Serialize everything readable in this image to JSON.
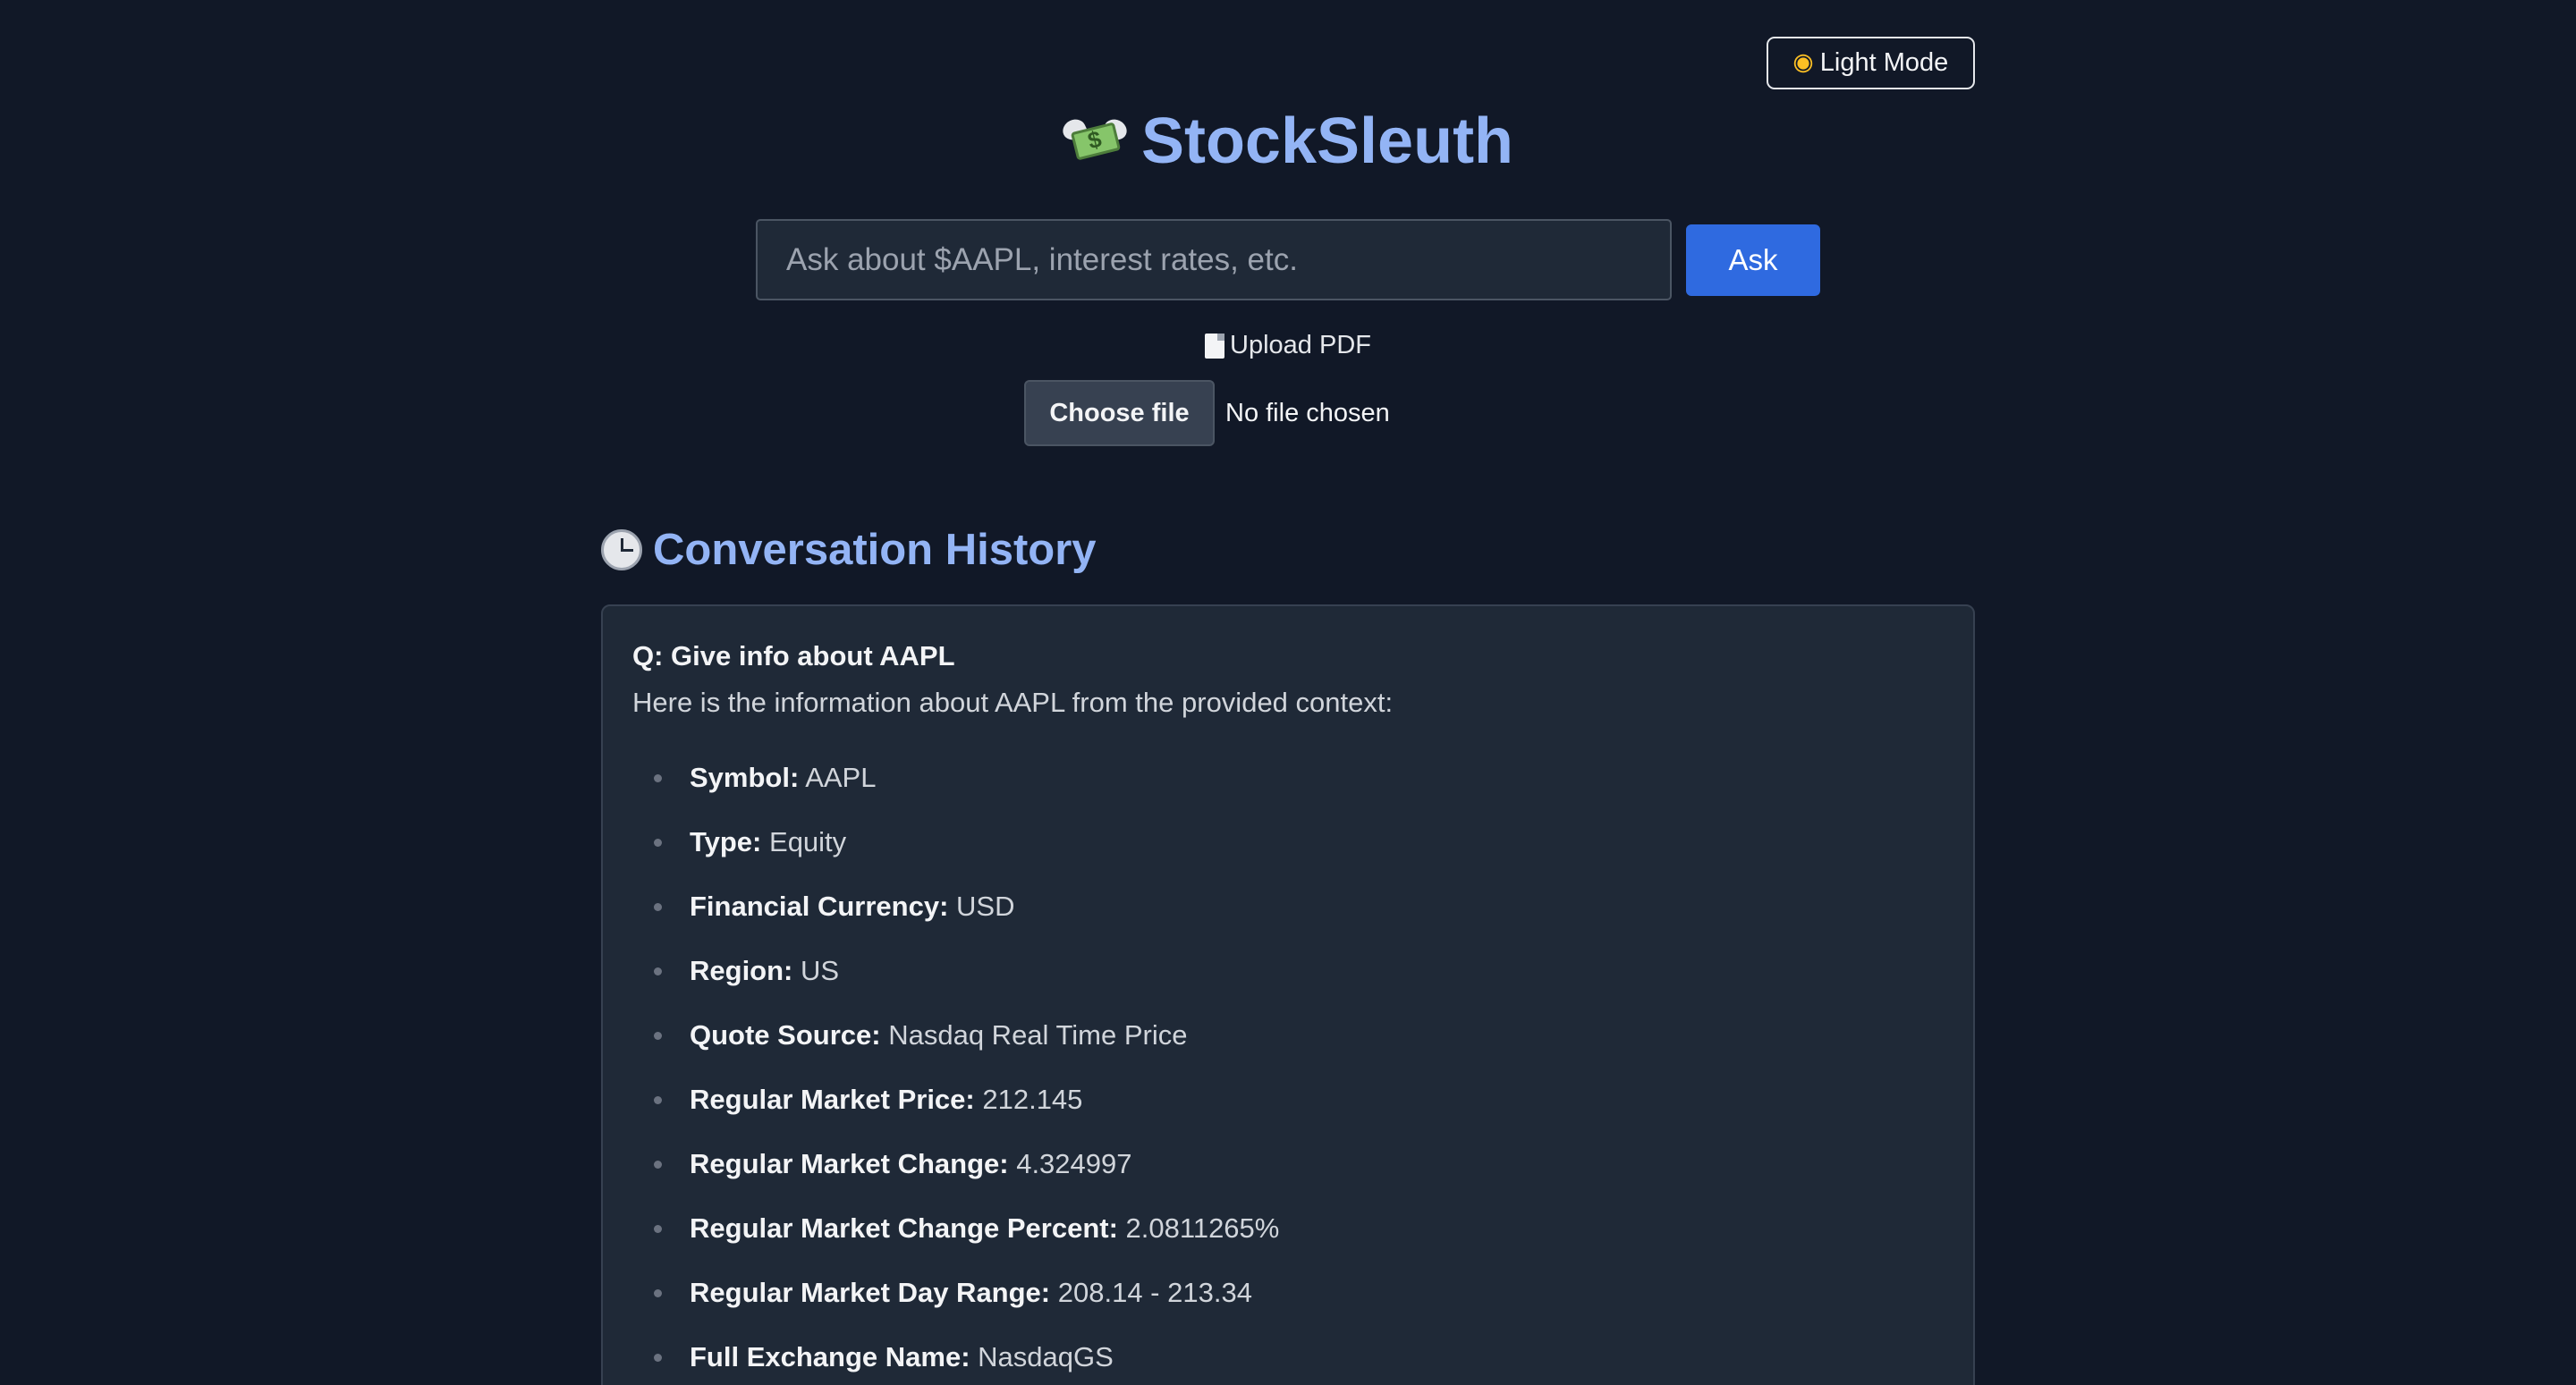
{
  "header": {
    "theme_toggle_label": "Light Mode",
    "theme_toggle_icon": "sun-icon",
    "title": "StockSleuth",
    "title_icon": "money-with-wings-icon"
  },
  "search": {
    "placeholder": "Ask about $AAPL, interest rates, etc.",
    "value": "",
    "ask_label": "Ask"
  },
  "upload": {
    "label": "Upload PDF",
    "icon": "document-icon",
    "choose_label": "Choose file",
    "status": "No file chosen"
  },
  "history": {
    "heading": "Conversation History",
    "icon": "clock-icon",
    "entries": [
      {
        "question": "Q: Give info about AAPL",
        "intro": "Here is the information about AAPL from the provided context:",
        "items": [
          {
            "key": "Symbol:",
            "value": "AAPL"
          },
          {
            "key": "Type:",
            "value": "Equity"
          },
          {
            "key": "Financial Currency:",
            "value": "USD"
          },
          {
            "key": "Region:",
            "value": "US"
          },
          {
            "key": "Quote Source:",
            "value": "Nasdaq Real Time Price"
          },
          {
            "key": "Regular Market Price:",
            "value": "212.145"
          },
          {
            "key": "Regular Market Change:",
            "value": "4.324997"
          },
          {
            "key": "Regular Market Change Percent:",
            "value": "2.0811265%"
          },
          {
            "key": "Regular Market Day Range:",
            "value": "208.14 - 213.34"
          },
          {
            "key": "Full Exchange Name:",
            "value": "NasdaqGS"
          }
        ]
      }
    ]
  },
  "colors": {
    "background": "#111827",
    "card": "#1f2937",
    "accent": "#93b4f5",
    "button": "#2f6ae0"
  }
}
